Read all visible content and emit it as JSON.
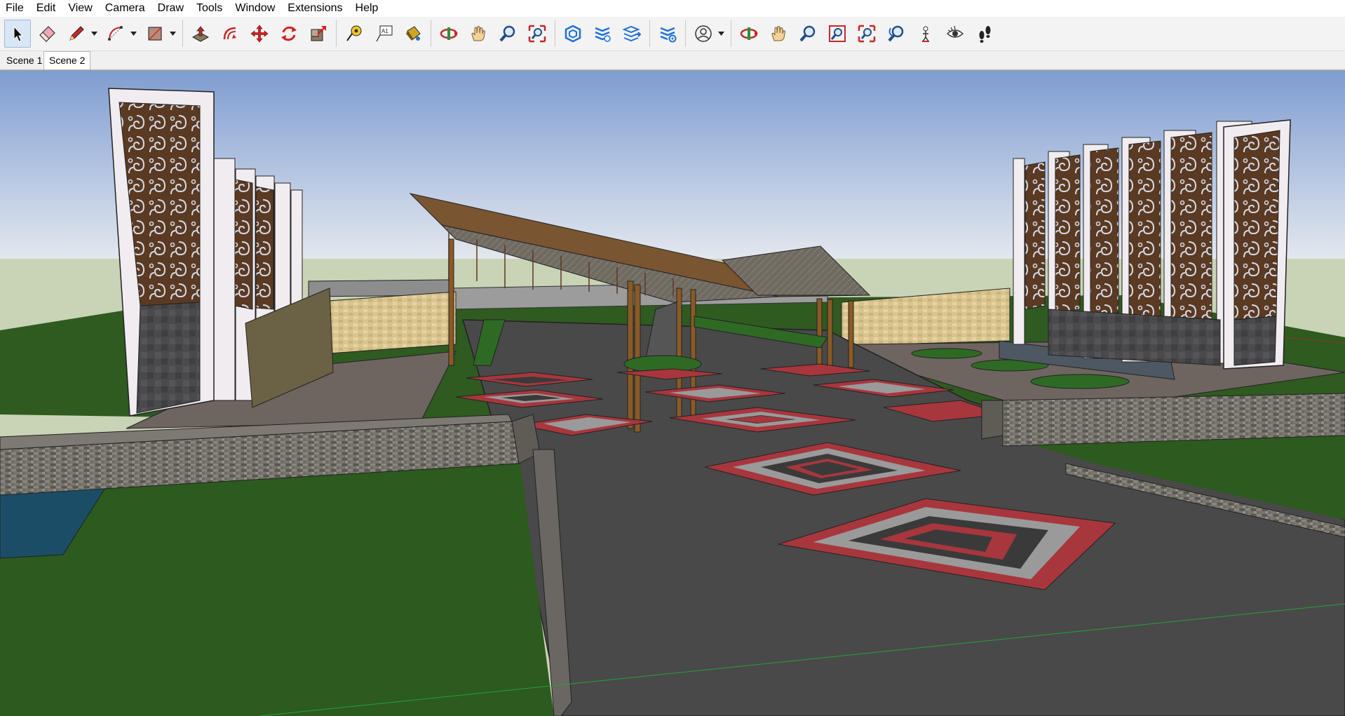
{
  "menubar": {
    "items": [
      {
        "label": "File"
      },
      {
        "label": "Edit"
      },
      {
        "label": "View"
      },
      {
        "label": "Camera"
      },
      {
        "label": "Draw"
      },
      {
        "label": "Tools"
      },
      {
        "label": "Window"
      },
      {
        "label": "Extensions"
      },
      {
        "label": "Help"
      }
    ]
  },
  "toolbar": {
    "active_tool": "select-tool",
    "tools": [
      "select",
      "eraser",
      "pencil",
      "arc",
      "shape",
      "push-pull",
      "offset",
      "move",
      "rotate",
      "scale",
      "tape-measure",
      "text",
      "paint-bucket",
      "orbit",
      "pan",
      "zoom",
      "zoom-extents",
      "3d-warehouse",
      "extension-warehouse",
      "layout",
      "extension-manager",
      "account",
      "orbit-2",
      "pan-2",
      "zoom-2",
      "zoom-window",
      "zoom-extents-2",
      "previous-view",
      "position-camera",
      "look-around",
      "walk"
    ],
    "icon_tab_label": "A1"
  },
  "scenes": {
    "tabs": [
      {
        "label": "Scene 1"
      },
      {
        "label": "Scene 2"
      }
    ],
    "selected": "Scene 2"
  },
  "colors": {
    "sky_top": "#7f9dd1",
    "sky_bottom": "#e4e8ee",
    "ground": "#c9d3b6",
    "lawn": "#2d5a1e",
    "asphalt": "#494949",
    "paving_red": "#a8363d",
    "paving_grey": "#9a9a9a",
    "stone_wall": "#6c6a64",
    "sandstone": "#d9c48e",
    "wood": "#8a5a26",
    "panel_white": "#f1ecef",
    "ornament_brown": "#5a3a22",
    "water": "#1b4d66",
    "accent": "#2870c8"
  }
}
